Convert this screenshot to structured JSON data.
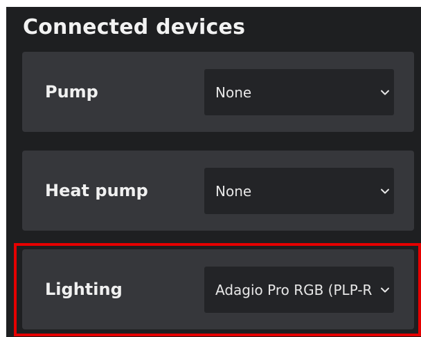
{
  "section": {
    "title": "Connected devices"
  },
  "devices": [
    {
      "label": "Pump",
      "selected": "None"
    },
    {
      "label": "Heat pump",
      "selected": "None"
    },
    {
      "label": "Lighting",
      "selected": "Adagio Pro RGB (PLP-R"
    }
  ],
  "icons": {
    "select_arrow": "chevron-down-icon"
  },
  "colors": {
    "background": "#1e1f21",
    "card": "#36373b",
    "select": "#232427",
    "text": "#f0f0f0",
    "highlight": "#e60000"
  }
}
